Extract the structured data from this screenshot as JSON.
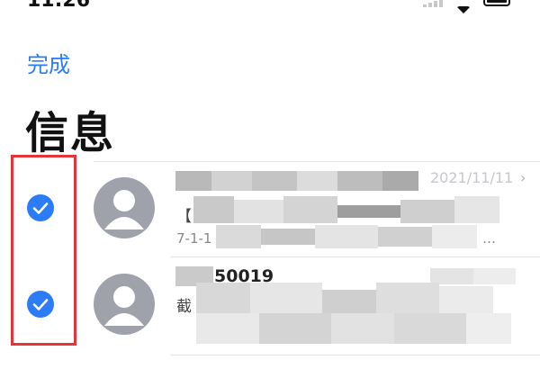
{
  "status_bar": {
    "time": "11:26"
  },
  "header": {
    "done_label": "完成"
  },
  "page": {
    "title": "信息"
  },
  "accent_color": "#2b7cf6",
  "selection_outline_color": "#e5333a",
  "messages": [
    {
      "selected": true,
      "avatar_icon": "person-avatar-icon",
      "time": "2021/11/11",
      "preview_prefix": "【",
      "preview_line2_start": "7-1-1",
      "preview_line2_end": "…"
    },
    {
      "selected": true,
      "avatar_icon": "person-avatar-icon",
      "sender_visible": "50019",
      "preview_prefix": "截"
    }
  ]
}
